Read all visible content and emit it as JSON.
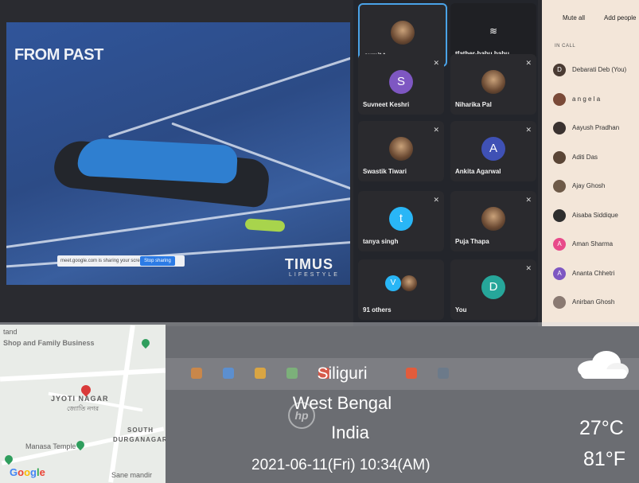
{
  "share": {
    "title": "FROM PAST",
    "brand": "TIMUS",
    "brand_sub": "LIFESTYLE",
    "share_notice": "meet.google.com is sharing your screen.",
    "stop_label": "Stop sharing"
  },
  "tiles": [
    {
      "name": "sumit t",
      "type": "photo"
    },
    {
      "name": "tfather-babu babu",
      "type": "plain"
    },
    {
      "name": "Suvneet Keshri",
      "type": "avatar",
      "letter": "S",
      "color": "#7e57c2"
    },
    {
      "name": "Niharika Pal",
      "type": "photo"
    },
    {
      "name": "Swastik Tiwari",
      "type": "photo"
    },
    {
      "name": "Ankita Agarwal",
      "type": "avatar",
      "letter": "A",
      "color": "#3f51b5"
    },
    {
      "name": "tanya singh",
      "type": "avatar",
      "letter": "t",
      "color": "#29b6f6"
    },
    {
      "name": "Puja Thapa",
      "type": "photo"
    },
    {
      "name": "91 others",
      "type": "others",
      "letter": "V"
    },
    {
      "name": "You",
      "type": "avatar",
      "letter": "D",
      "color": "#26a69a"
    }
  ],
  "panel": {
    "mute_all": "Mute all",
    "add_people": "Add people",
    "in_call": "IN CALL",
    "people": [
      {
        "name": "Debarati Deb (You)",
        "letter": "D",
        "color": "#4a3b33"
      },
      {
        "name": "a n g e l a",
        "letter": "",
        "color": "#7a4a38"
      },
      {
        "name": "Aayush Pradhan",
        "letter": "",
        "color": "#3a3230"
      },
      {
        "name": "Aditi Das",
        "letter": "",
        "color": "#5a4536"
      },
      {
        "name": "Ajay Ghosh",
        "letter": "",
        "color": "#6e5a48"
      },
      {
        "name": "Aisaba Siddique",
        "letter": "",
        "color": "#2e2e2e"
      },
      {
        "name": "Aman Sharma",
        "letter": "A",
        "color": "#e84a8a"
      },
      {
        "name": "Ananta Chhetri",
        "letter": "A",
        "color": "#7e57c2"
      },
      {
        "name": "Anirban Ghosh",
        "letter": "",
        "color": "#8a7a72"
      }
    ]
  },
  "overlay": {
    "city": "Siliguri",
    "state": "West Bengal",
    "country": "India",
    "datetime": "2021-06-11(Fri)  10:34(AM)",
    "temp_c": "27°C",
    "temp_f": "81°F",
    "weather_icon": "cloud-icon",
    "hp_logo": "hp"
  },
  "map": {
    "labels": {
      "top_left": "tand",
      "business": "Shop and Family Business",
      "locality": "JYOTI NAGAR",
      "locality_bn": "জ্যোতি নগর",
      "temple": "Manasa Temple",
      "south": "SOUTH",
      "durganagar": "DURGANAGAR",
      "sane": "Sane mandir"
    },
    "google": "Google"
  }
}
